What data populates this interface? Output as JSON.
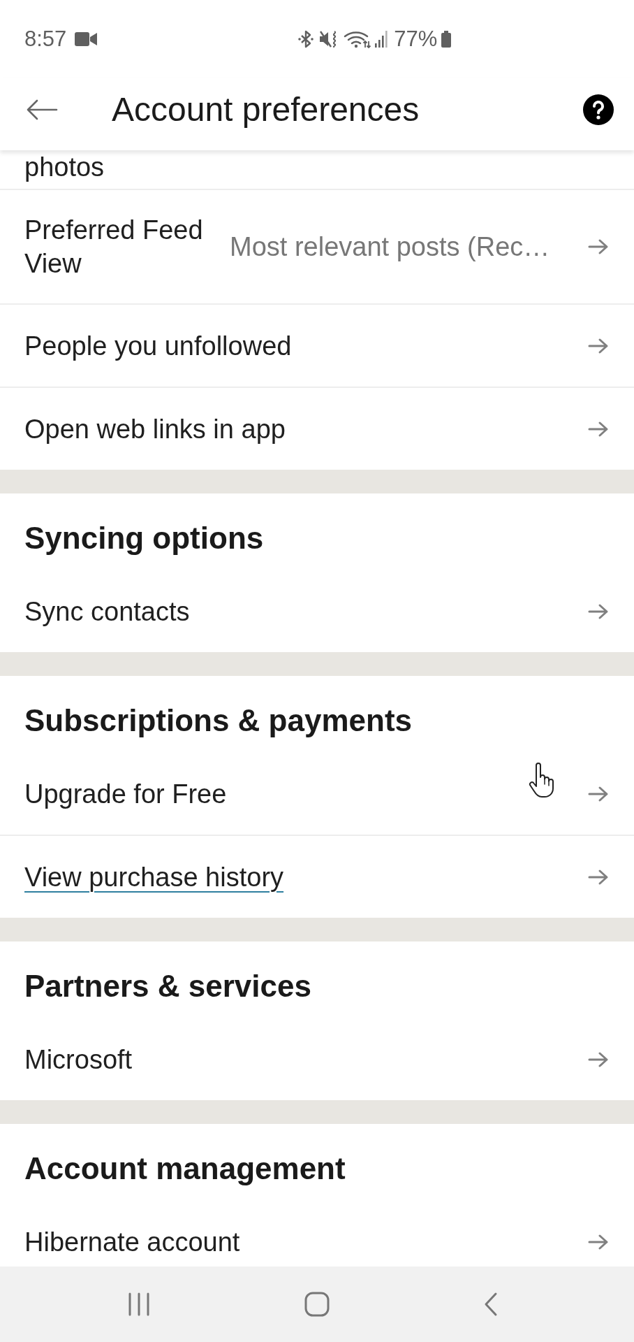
{
  "status_bar": {
    "time": "8:57",
    "battery_percent": "77%"
  },
  "header": {
    "title": "Account preferences"
  },
  "sections": [
    {
      "rows": [
        {
          "kind": "partial",
          "label": "photos"
        },
        {
          "kind": "nav",
          "label": "Preferred Feed View",
          "value": "Most relevant posts (Rec…"
        },
        {
          "kind": "nav",
          "label": "People you unfollowed"
        },
        {
          "kind": "nav",
          "label": "Open web links in app"
        }
      ]
    },
    {
      "heading": "Syncing options",
      "rows": [
        {
          "kind": "nav",
          "label": "Sync contacts"
        }
      ]
    },
    {
      "heading": "Subscriptions & payments",
      "rows": [
        {
          "kind": "nav",
          "label": "Upgrade for Free"
        },
        {
          "kind": "link",
          "label": "View purchase history"
        }
      ]
    },
    {
      "heading": "Partners & services",
      "rows": [
        {
          "kind": "nav",
          "label": "Microsoft"
        }
      ]
    },
    {
      "heading": "Account management",
      "rows": [
        {
          "kind": "nav",
          "label": "Hibernate account"
        }
      ]
    }
  ]
}
